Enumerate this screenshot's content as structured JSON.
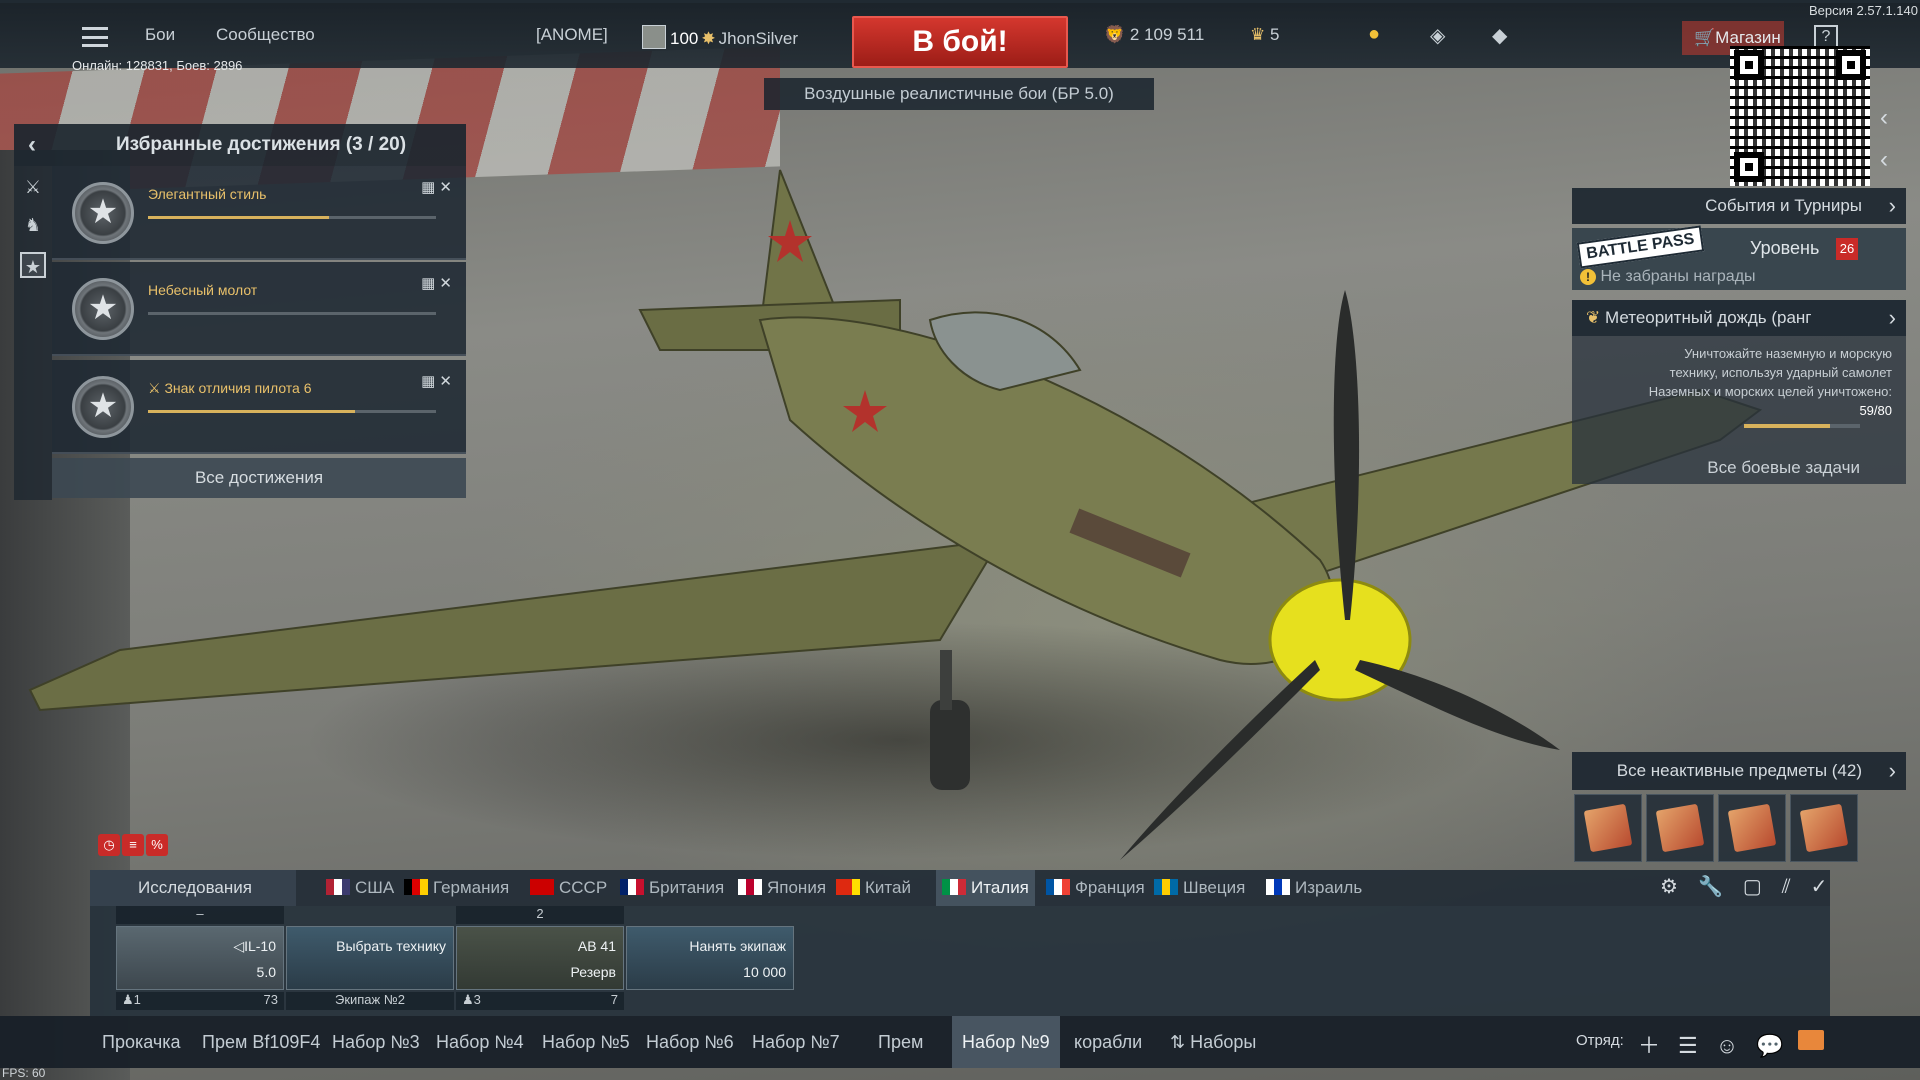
{
  "version": "Версия 2.57.1.140",
  "topbar": {
    "battles": "Бои",
    "community": "Сообщество",
    "squadron_tag": "[ANOME]",
    "level": "100",
    "player_name": "JhonSilver",
    "battle_button": "В бой!",
    "silver_lions": "2 109 511",
    "golden_eagles": "5",
    "shop": "Магазин",
    "help": "?"
  },
  "game_mode": "Воздушные реалистичные бои (БР 5.0)",
  "online_stats": "Онлайн: 128831, Боев: 2896",
  "achievements": {
    "title": "Избранные достижения (3 / 20)",
    "items": [
      {
        "name": "Элегантный стиль",
        "progress": 0.63
      },
      {
        "name": "Небесный молот",
        "progress": 0.0
      },
      {
        "name": "Знак отличия пилота 6",
        "progress": 0.72
      }
    ],
    "all_button": "Все достижения"
  },
  "right_panel": {
    "events": "События и Турниры",
    "battle_pass_logo": "BATTLE PASS",
    "bp_level_label": "Уровень",
    "bp_level": "26",
    "bp_warning": "Не забраны награды",
    "task_title": "Метеоритный дождь (ранг",
    "task_desc_1": "Уничтожайте наземную и морскую",
    "task_desc_2": "технику, используя ударный самолет",
    "task_desc_3": "Наземных и морских целей уничтожено:",
    "task_count": "59/80",
    "task_progress": 0.74,
    "all_tasks": "Все боевые задачи",
    "inactive_items": "Все неактивные предметы (42)"
  },
  "research": "Исследования",
  "countries": [
    {
      "name": "США",
      "flag": [
        "#b22234",
        "#ffffff",
        "#3c3b6e"
      ]
    },
    {
      "name": "Германия",
      "flag": [
        "#000000",
        "#dd0000",
        "#ffce00"
      ]
    },
    {
      "name": "СССР",
      "flag": [
        "#cc0000",
        "#cc0000",
        "#cc0000"
      ]
    },
    {
      "name": "Британия",
      "flag": [
        "#012169",
        "#ffffff",
        "#c8102e"
      ]
    },
    {
      "name": "Япония",
      "flag": [
        "#ffffff",
        "#bc002d",
        "#ffffff"
      ]
    },
    {
      "name": "Китай",
      "flag": [
        "#de2910",
        "#de2910",
        "#ffde00"
      ]
    },
    {
      "name": "Италия",
      "flag": [
        "#009246",
        "#ffffff",
        "#ce2b37"
      ]
    },
    {
      "name": "Франция",
      "flag": [
        "#0055a4",
        "#ffffff",
        "#ef4135"
      ]
    },
    {
      "name": "Швеция",
      "flag": [
        "#006aa7",
        "#fecc00",
        "#006aa7"
      ]
    },
    {
      "name": "Израиль",
      "flag": [
        "#ffffff",
        "#0038b8",
        "#ffffff"
      ]
    }
  ],
  "active_country": "Италия",
  "slots": {
    "s1": {
      "header": "–",
      "name": "◁IL-10",
      "br": "5.0",
      "crew": "1",
      "skill": "73"
    },
    "s2": {
      "label": "Выбрать технику",
      "footer": "Экипаж №2"
    },
    "s3": {
      "header": "2",
      "name": "AB 41",
      "br": "Резерв",
      "crew": "3",
      "skill": "7"
    },
    "s4": {
      "label": "Нанять экипаж",
      "cost": "10 000"
    }
  },
  "presets": [
    "Прокачка",
    "Прем Bf109F4",
    "Набор №3",
    "Набор №4",
    "Набор №5",
    "Набор №6",
    "Набор №7",
    "Прем",
    "Набор №9",
    "корабли"
  ],
  "active_preset": "Набор №9",
  "presets_button": "Наборы",
  "squad_label": "Отряд:",
  "fps": "FPS: 60",
  "colors": {
    "accent_red": "#c92b28",
    "progress_gold": "#d8b25c",
    "panel": "#1c2630"
  }
}
